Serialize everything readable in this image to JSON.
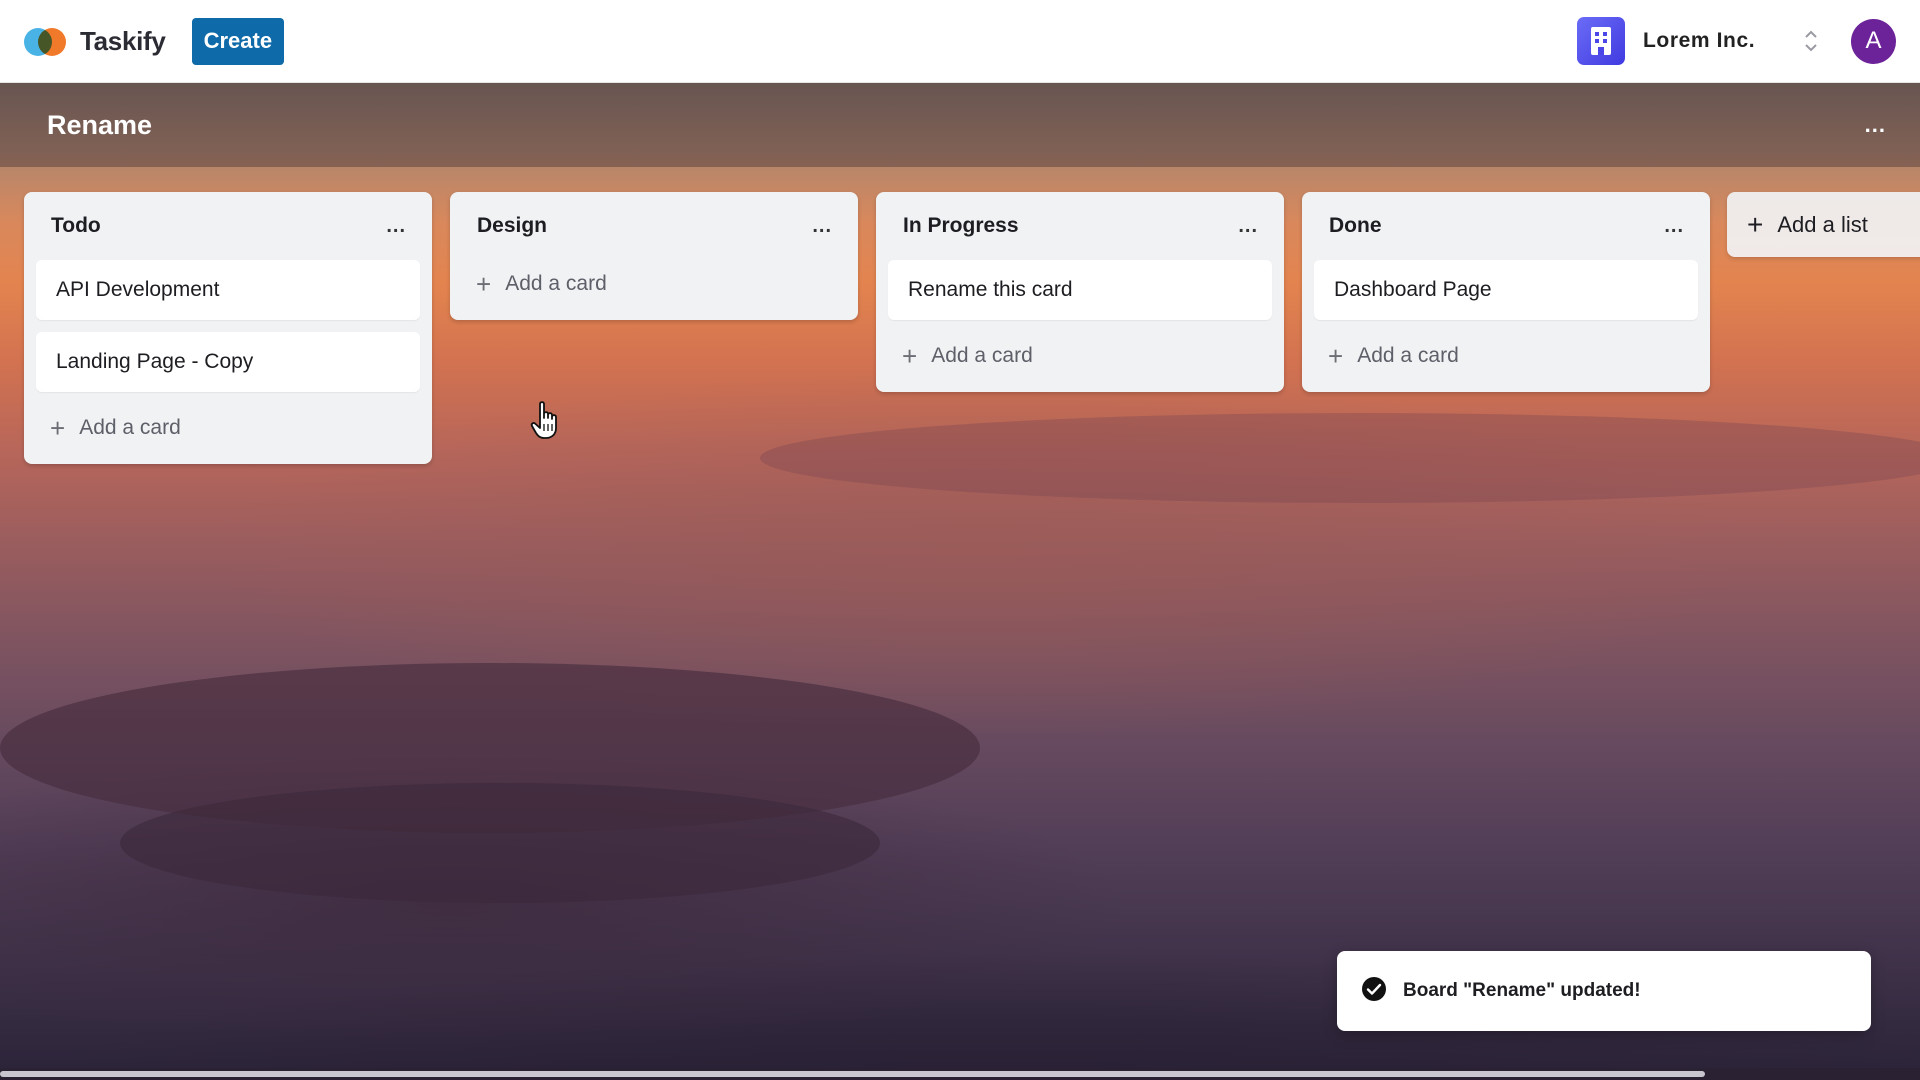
{
  "app": {
    "name": "Taskify",
    "create_label": "Create"
  },
  "org": {
    "name": "Lorem Inc.",
    "icon": "building-icon"
  },
  "user": {
    "avatar_initial": "A",
    "avatar_color": "#6c2399"
  },
  "board": {
    "title": "Rename",
    "menu_label": "...",
    "add_list_label": "Add a list",
    "lists": [
      {
        "title": "Todo",
        "menu_label": "...",
        "cards": [
          "API Development",
          "Landing Page - Copy"
        ],
        "add_card_label": "Add a card"
      },
      {
        "title": "Design",
        "menu_label": "...",
        "cards": [],
        "add_card_label": "Add a card"
      },
      {
        "title": "In Progress",
        "menu_label": "...",
        "cards": [
          "Rename this card"
        ],
        "add_card_label": "Add a card"
      },
      {
        "title": "Done",
        "menu_label": "...",
        "cards": [
          "Dashboard Page"
        ],
        "add_card_label": "Add a card"
      }
    ]
  },
  "toast": {
    "message": "Board \"Rename\" updated!",
    "icon": "check-circle-icon"
  },
  "colors": {
    "create_button": "#0e6aa8",
    "org_icon": "#5552ee",
    "avatar": "#6c2399"
  }
}
